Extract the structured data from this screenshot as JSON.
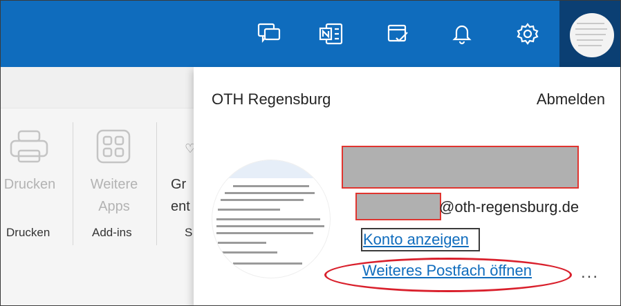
{
  "topbar": {
    "icons": [
      "feedback-icon",
      "onenote-icon",
      "my-day-icon",
      "bell-icon",
      "gear-icon"
    ]
  },
  "ribbon": {
    "print_label": "Drucken",
    "more_apps_line1": "Weitere",
    "more_apps_line2": "Apps",
    "partial_line1": "Gr",
    "partial_line2": "ent",
    "group_print": "Drucken",
    "group_addins": "Add-ins",
    "group_partial": "S"
  },
  "account": {
    "organization": "OTH Regensburg",
    "sign_out": "Abmelden",
    "email_domain": "@oth-regensburg.de",
    "view_account": "Konto anzeigen",
    "open_mailbox": "Weiteres Postfach öffnen",
    "more": "..."
  },
  "colors": {
    "topbar": "#0f6cbd",
    "link": "#0f6cbd",
    "annotation_red": "#d9202c"
  }
}
